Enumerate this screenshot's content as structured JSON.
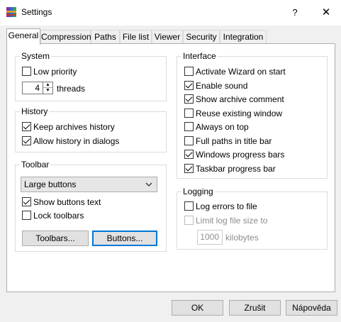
{
  "window": {
    "title": "Settings",
    "help_label": "?",
    "close_label": "✕"
  },
  "tabs": [
    {
      "label": "General",
      "active": true
    },
    {
      "label": "Compression",
      "active": false
    },
    {
      "label": "Paths",
      "active": false
    },
    {
      "label": "File list",
      "active": false
    },
    {
      "label": "Viewer",
      "active": false
    },
    {
      "label": "Security",
      "active": false
    },
    {
      "label": "Integration",
      "active": false
    }
  ],
  "system": {
    "title": "System",
    "low_priority": {
      "label": "Low priority",
      "checked": false
    },
    "threads_value": "4",
    "threads_label": "threads"
  },
  "history": {
    "title": "History",
    "keep_archives": {
      "label": "Keep archives history",
      "checked": true
    },
    "allow_dialogs": {
      "label": "Allow history in dialogs",
      "checked": true
    }
  },
  "toolbar": {
    "title": "Toolbar",
    "size_selected": "Large buttons",
    "show_text": {
      "label": "Show buttons text",
      "checked": true
    },
    "lock": {
      "label": "Lock toolbars",
      "checked": false
    },
    "toolbars_button": "Toolbars...",
    "buttons_button": "Buttons..."
  },
  "interface": {
    "title": "Interface",
    "items": [
      {
        "label": "Activate Wizard on start",
        "checked": false
      },
      {
        "label": "Enable sound",
        "checked": true
      },
      {
        "label": "Show archive comment",
        "checked": true
      },
      {
        "label": "Reuse existing window",
        "checked": false
      },
      {
        "label": "Always on top",
        "checked": false
      },
      {
        "label": "Full paths in title bar",
        "checked": false
      },
      {
        "label": "Windows progress bars",
        "checked": true
      },
      {
        "label": "Taskbar progress bar",
        "checked": true
      }
    ]
  },
  "logging": {
    "title": "Logging",
    "log_errors": {
      "label": "Log errors to file",
      "checked": false
    },
    "limit_size": {
      "label": "Limit log file size to",
      "checked": false,
      "disabled": true
    },
    "size_value": "1000",
    "size_unit": "kilobytes"
  },
  "footer": {
    "ok": "OK",
    "cancel": "Zrušit",
    "help": "Nápověda"
  },
  "colors": {
    "default_button_border": "#0078d7",
    "dialog_background": "#f0f0f0"
  }
}
